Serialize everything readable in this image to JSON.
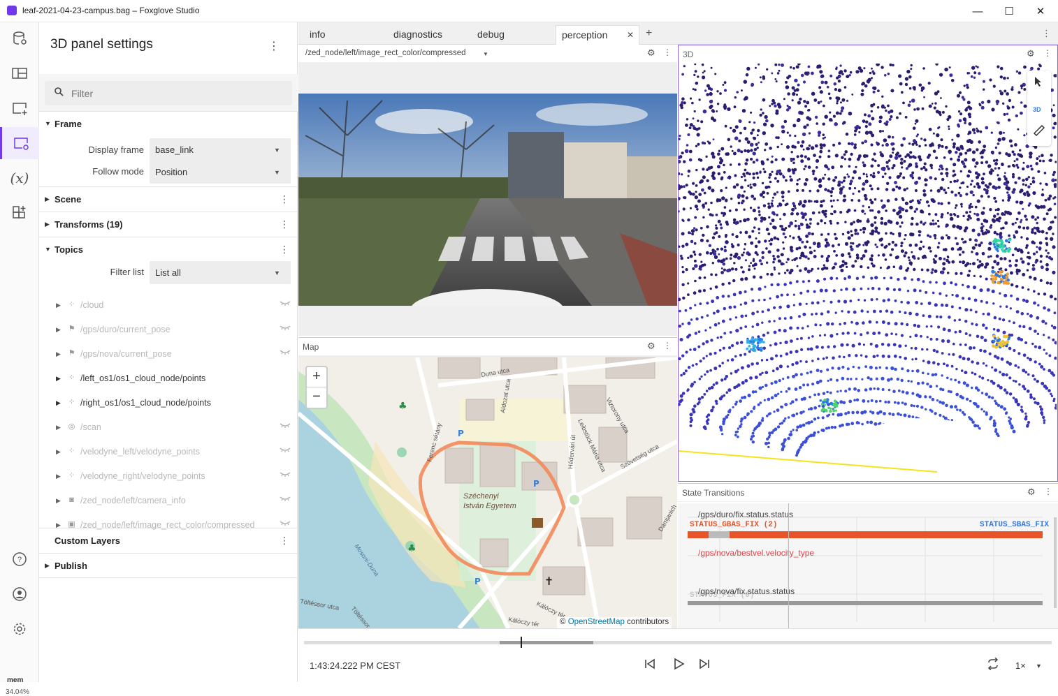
{
  "window": {
    "title": "leaf-2021-04-23-campus.bag – Foxglove Studio",
    "minimize": "—",
    "maximize": "☐",
    "close": "✕"
  },
  "sidebar": {
    "icons": [
      "data-source-icon",
      "layout-icon",
      "add-panel-icon",
      "panel-settings-icon",
      "variables-icon",
      "extensions-icon",
      "help-icon",
      "account-icon",
      "preferences-icon"
    ],
    "variables_glyph": "(x)",
    "mem_label": "mem",
    "mem_value": "34.04%"
  },
  "settings": {
    "title": "3D panel settings",
    "menu": "⋮",
    "filter_placeholder": "Filter",
    "sections": {
      "frame": "Frame",
      "scene": "Scene",
      "transforms": "Transforms (19)",
      "topics": "Topics",
      "custom_layers": "Custom Layers",
      "publish": "Publish"
    },
    "display_frame_label": "Display frame",
    "display_frame_value": "base_link",
    "follow_mode_label": "Follow mode",
    "follow_mode_value": "Position",
    "filter_list_label": "Filter list",
    "filter_list_value": "List all",
    "topics": [
      {
        "name": "/cloud",
        "icon": "points-icon",
        "glyph": "⁘",
        "enabled": false
      },
      {
        "name": "/gps/duro/current_pose",
        "icon": "flag-icon",
        "glyph": "⚑",
        "enabled": false
      },
      {
        "name": "/gps/nova/current_pose",
        "icon": "flag-icon",
        "glyph": "⚑",
        "enabled": false
      },
      {
        "name": "/left_os1/os1_cloud_node/points",
        "icon": "points-icon",
        "glyph": "⁘",
        "enabled": true
      },
      {
        "name": "/right_os1/os1_cloud_node/points",
        "icon": "points-icon",
        "glyph": "⁘",
        "enabled": true
      },
      {
        "name": "/scan",
        "icon": "scan-icon",
        "glyph": "◎",
        "enabled": false
      },
      {
        "name": "/velodyne_left/velodyne_points",
        "icon": "points-icon",
        "glyph": "⁘",
        "enabled": false
      },
      {
        "name": "/velodyne_right/velodyne_points",
        "icon": "points-icon",
        "glyph": "⁘",
        "enabled": false
      },
      {
        "name": "/zed_node/left/camera_info",
        "icon": "camera-icon",
        "glyph": "◙",
        "enabled": false
      },
      {
        "name": "/zed_node/left/image_rect_color/compressed",
        "icon": "image-icon",
        "glyph": "▣",
        "enabled": false
      }
    ]
  },
  "tabs": [
    {
      "label": "info",
      "active": false
    },
    {
      "label": "diagnostics",
      "active": false
    },
    {
      "label": "debug",
      "active": false
    },
    {
      "label": "perception",
      "active": true
    }
  ],
  "tab_close": "✕",
  "tab_add": "+",
  "tab_menu": "⋮",
  "image_panel": {
    "topic": "/zed_node/left/image_rect_color/compressed",
    "gear": "⚙",
    "dots": "⋮"
  },
  "map_panel": {
    "title": "Map",
    "zoom_in": "+",
    "zoom_out": "−",
    "attribution_prefix": "©",
    "attribution_link": "OpenStreetMap",
    "attribution_suffix": "contributors",
    "labels": [
      "Duna utca",
      "Aldozat utca",
      "Ferenc sétány",
      "Széchenyi",
      "István Egyetem",
      "Mosoni-Duna",
      "Leibstück Mária utca",
      "Hédervári út",
      "Viztorony utca",
      "Szövetség utca",
      "Damjanich",
      "Kálóczy tér",
      "Kálóczy tér",
      "Töltéssor utca",
      "Töltéssor"
    ],
    "map_glyphs": {
      "park": "♣",
      "parking": "P",
      "church": "✝",
      "library": "📖"
    }
  },
  "three_panel": {
    "title": "3D",
    "gear": "⚙",
    "dots": "⋮",
    "mode_3d": "3D",
    "tool_select": "select-icon",
    "tool_ruler": "ruler-icon"
  },
  "state_panel": {
    "title": "State Transitions",
    "series": [
      {
        "path": "/gps/duro/fix.status.status",
        "value_left": "STATUS_GBAS_FIX (2)",
        "value_right": "STATUS_SBAS_FIX",
        "path_color": "#444444",
        "bar_color": "#e8542a"
      },
      {
        "path": "/gps/nova/bestvel.velocity_type",
        "value_left": "",
        "value_right": "",
        "path_color": "#e0444a",
        "bar_color": ""
      },
      {
        "path": "/gps/nova/fix.status.status",
        "value_left": "STATUS_FIX (0)",
        "value_right": "",
        "path_color": "#444444",
        "bar_color": "#9a9a9a"
      }
    ]
  },
  "playback": {
    "time": "1:43:24.222 PM CEST",
    "speed": "1×",
    "progress": 0.29,
    "buttons": [
      "seek-back-icon",
      "play-icon",
      "seek-forward-icon",
      "loop-icon"
    ]
  },
  "colors": {
    "accent": "#6f3be8",
    "route": "#f28a5a"
  }
}
